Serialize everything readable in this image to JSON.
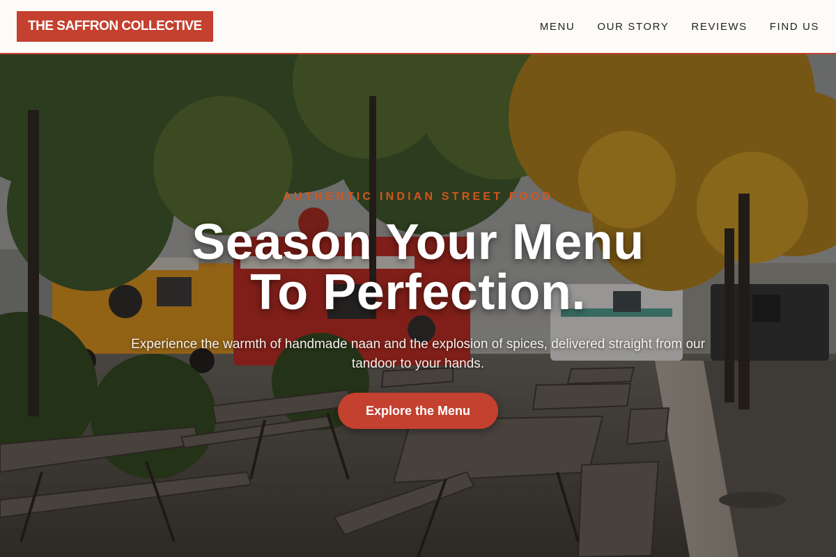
{
  "header": {
    "logo": "THE SAFFRON COLLECTIVE",
    "nav": [
      {
        "label": "MENU"
      },
      {
        "label": "OUR STORY"
      },
      {
        "label": "REVIEWS"
      },
      {
        "label": "FIND US"
      }
    ]
  },
  "hero": {
    "eyebrow": "AUTHENTIC INDIAN STREET FOOD",
    "title_line1": "Season Your Menu",
    "title_line2": "To Perfection.",
    "subtitle": "Experience the warmth of handmade naan and the explosion of spices, delivered straight from our tandoor to your hands.",
    "cta_label": "Explore the Menu"
  },
  "colors": {
    "brand": "#c4402f",
    "accent": "#d2561f",
    "header_bg": "#fdfbf8"
  }
}
